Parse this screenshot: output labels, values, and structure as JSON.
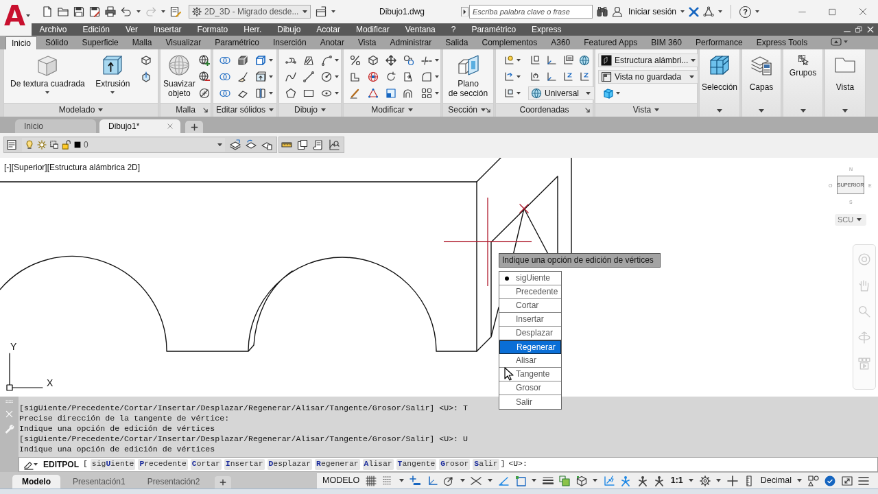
{
  "app_button": {
    "label": "A"
  },
  "title_bar": {
    "workspace": "2D_3D - Migrado desde...",
    "document_title": "Dibujo1.dwg",
    "search": {
      "placeholder": "Escriba palabra clave o frase"
    },
    "sign_in": "Iniciar sesión",
    "help": "?"
  },
  "menu_bar": [
    "Archivo",
    "Edición",
    "Ver",
    "Insertar",
    "Formato",
    "Herr.",
    "Dibujo",
    "Acotar",
    "Modificar",
    "Ventana",
    "?",
    "Paramétrico",
    "Express"
  ],
  "ribbon_tabs": [
    {
      "label": "Inicio",
      "selected": true
    },
    {
      "label": "Sólido",
      "selected": false
    },
    {
      "label": "Superficie",
      "selected": false
    },
    {
      "label": "Malla",
      "selected": false
    },
    {
      "label": "Visualizar",
      "selected": false
    },
    {
      "label": "Paramétrico",
      "selected": false
    },
    {
      "label": "Inserción",
      "selected": false
    },
    {
      "label": "Anotar",
      "selected": false
    },
    {
      "label": "Vista",
      "selected": false
    },
    {
      "label": "Administrar",
      "selected": false
    },
    {
      "label": "Salida",
      "selected": false
    },
    {
      "label": "Complementos",
      "selected": false
    },
    {
      "label": "A360",
      "selected": false
    },
    {
      "label": "Featured Apps",
      "selected": false
    },
    {
      "label": "BIM 360",
      "selected": false
    },
    {
      "label": "Performance",
      "selected": false
    },
    {
      "label": "Express Tools",
      "selected": false
    }
  ],
  "ribbon_panels": [
    {
      "title": "Modelado",
      "menu": true,
      "launcher": false,
      "buttons": [
        {
          "label": "De textura cuadrada",
          "dropdown": true
        },
        {
          "label": "Extrusión",
          "dropdown": true
        }
      ]
    },
    {
      "title": "Malla",
      "menu": false,
      "launcher": true,
      "buttons": [
        {
          "label": "Suavizar\nobjeto",
          "dropdown": false
        }
      ]
    },
    {
      "title": "Editar sólidos",
      "menu": true,
      "launcher": false
    },
    {
      "title": "Dibujo",
      "menu": true,
      "launcher": false
    },
    {
      "title": "Modificar",
      "menu": true,
      "launcher": false
    },
    {
      "title": "Sección",
      "menu": true,
      "launcher": true,
      "buttons": [
        {
          "label": "Plano\nde sección",
          "dropdown": false
        }
      ]
    },
    {
      "title": "Coordenadas",
      "menu": false,
      "launcher": true,
      "dropdowns": [
        "Universal"
      ]
    },
    {
      "title": "Vista",
      "menu": true,
      "launcher": false,
      "dropdowns": [
        "Estructura alámbri...",
        "Vista no guardada"
      ]
    }
  ],
  "collapsed_panels": [
    {
      "label": "Selección"
    },
    {
      "label": "Capas"
    },
    {
      "label": "Grupos"
    },
    {
      "label": "Vista"
    }
  ],
  "file_tabs": [
    {
      "label": "Inicio",
      "selected": false
    },
    {
      "label": "Dibujo1*",
      "selected": true
    }
  ],
  "layer_toolbar": {
    "current_layer": "0"
  },
  "viewport": {
    "label": "[-][Superior][Estructura alámbrica 2D]",
    "viewcube": {
      "face": "SUPERIOR",
      "north": "N",
      "west": "O",
      "east": "E",
      "south": "S"
    },
    "ucs_menu": "SCU",
    "ucs_icon": {
      "x_label": "X",
      "y_label": "Y"
    },
    "dynamic_prompt": "Indique una opción de edición de vértices",
    "dynamic_menu": [
      {
        "label": "sigUiente",
        "default": true,
        "selected": false
      },
      {
        "label": "Precedente",
        "default": false,
        "selected": false
      },
      {
        "label": "Cortar",
        "default": false,
        "selected": false
      },
      {
        "label": "Insertar",
        "default": false,
        "selected": false
      },
      {
        "label": "Desplazar",
        "default": false,
        "selected": false
      },
      {
        "label": "Regenerar",
        "default": false,
        "selected": true
      },
      {
        "label": "Alisar",
        "default": false,
        "selected": false
      },
      {
        "label": "Tangente",
        "default": false,
        "selected": false
      },
      {
        "label": "Grosor",
        "default": false,
        "selected": false
      },
      {
        "label": "Salir",
        "default": false,
        "selected": false
      }
    ]
  },
  "command_line": {
    "history": [
      "[sigUiente/Precedente/Cortar/Insertar/Desplazar/Regenerar/Alisar/Tangente/Grosor/Salir] <U>: T",
      "Precise dirección de la tangente de vértice:",
      "Indique una opción de edición de vértices",
      "[sigUiente/Precedente/Cortar/Insertar/Desplazar/Regenerar/Alisar/Tangente/Grosor/Salir] <U>: U",
      "Indique una opción de edición de vértices"
    ],
    "input": {
      "command": "EDITPOL",
      "open_bracket": "[",
      "options": [
        "sig**U**iente",
        "**P**recedente",
        "**C**ortar",
        "**I**nsertar",
        "**D**esplazar",
        "**R**egenerar",
        "**A**lisar",
        "**T**angente",
        "**G**rosor",
        "**S**alir"
      ],
      "close_bracket": "]",
      "default": "<U>:"
    }
  },
  "layout_tabs": [
    {
      "label": "Modelo",
      "selected": true
    },
    {
      "label": "Presentación1",
      "selected": false
    },
    {
      "label": "Presentación2",
      "selected": false
    }
  ],
  "status_bar": {
    "space": "MODELO",
    "scale": "1:1",
    "units": "Decimal"
  }
}
